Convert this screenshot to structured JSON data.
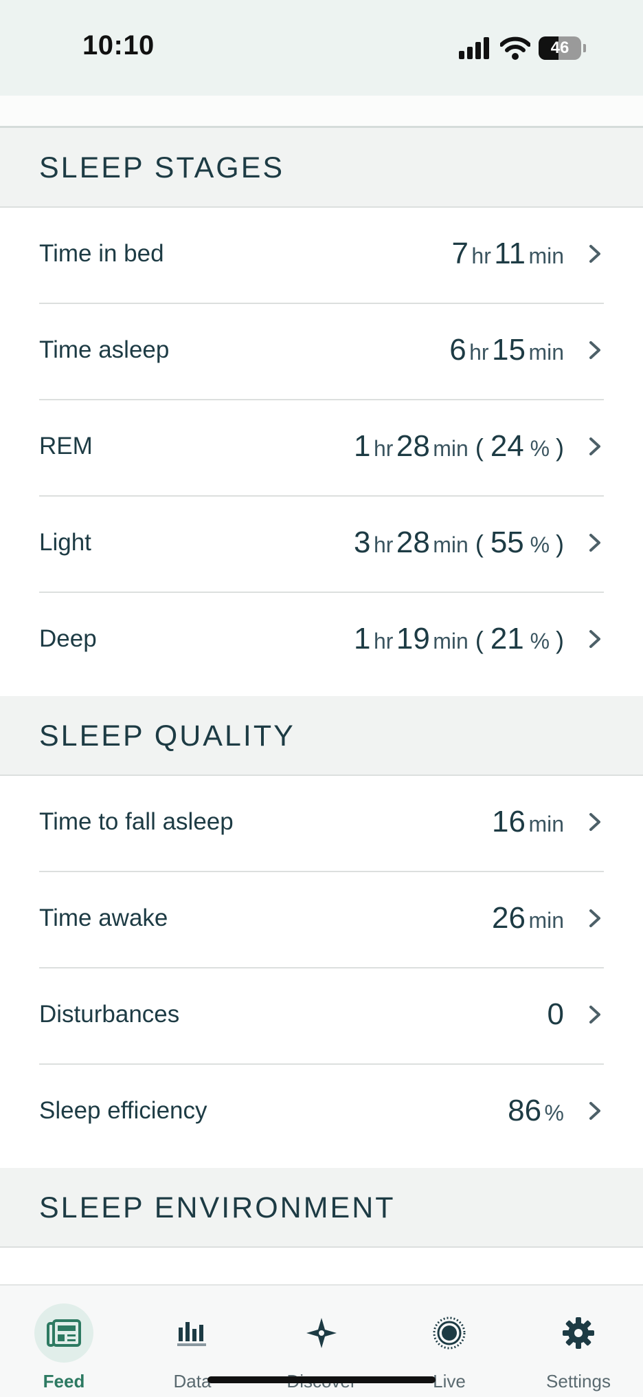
{
  "status_bar": {
    "time": "10:10",
    "battery": "46"
  },
  "sections": [
    {
      "title": "SLEEP STAGES",
      "rows": [
        {
          "label": "Time in bed",
          "value": [
            [
              "7",
              "hr"
            ],
            [
              "11",
              "min"
            ]
          ]
        },
        {
          "label": "Time asleep",
          "value": [
            [
              "6",
              "hr"
            ],
            [
              "15",
              "min"
            ]
          ]
        },
        {
          "label": "REM",
          "value": [
            [
              "1",
              "hr"
            ],
            [
              "28",
              "min"
            ]
          ],
          "pct": "24"
        },
        {
          "label": "Light",
          "value": [
            [
              "3",
              "hr"
            ],
            [
              "28",
              "min"
            ]
          ],
          "pct": "55"
        },
        {
          "label": "Deep",
          "value": [
            [
              "1",
              "hr"
            ],
            [
              "19",
              "min"
            ]
          ],
          "pct": "21"
        }
      ]
    },
    {
      "title": "SLEEP QUALITY",
      "rows": [
        {
          "label": "Time to fall asleep",
          "value": [
            [
              "16",
              "min"
            ]
          ]
        },
        {
          "label": "Time awake",
          "value": [
            [
              "26",
              "min"
            ]
          ]
        },
        {
          "label": "Disturbances",
          "value": [
            [
              "0",
              ""
            ]
          ]
        },
        {
          "label": "Sleep efficiency",
          "value": [
            [
              "86",
              "%"
            ]
          ]
        }
      ]
    },
    {
      "title": "SLEEP ENVIRONMENT",
      "rows": []
    }
  ],
  "tab_bar": {
    "items": [
      {
        "label": "Feed",
        "icon": "feed-icon",
        "active": true
      },
      {
        "label": "Data",
        "icon": "bar-chart-icon",
        "active": false
      },
      {
        "label": "Discover",
        "icon": "compass-star-icon",
        "active": false
      },
      {
        "label": "Live",
        "icon": "live-target-icon",
        "active": false
      },
      {
        "label": "Settings",
        "icon": "gear-icon",
        "active": false
      }
    ]
  },
  "colors": {
    "accent": "#2d7a62",
    "text": "#1d3b44",
    "header_bg": "#f1f3f2"
  }
}
